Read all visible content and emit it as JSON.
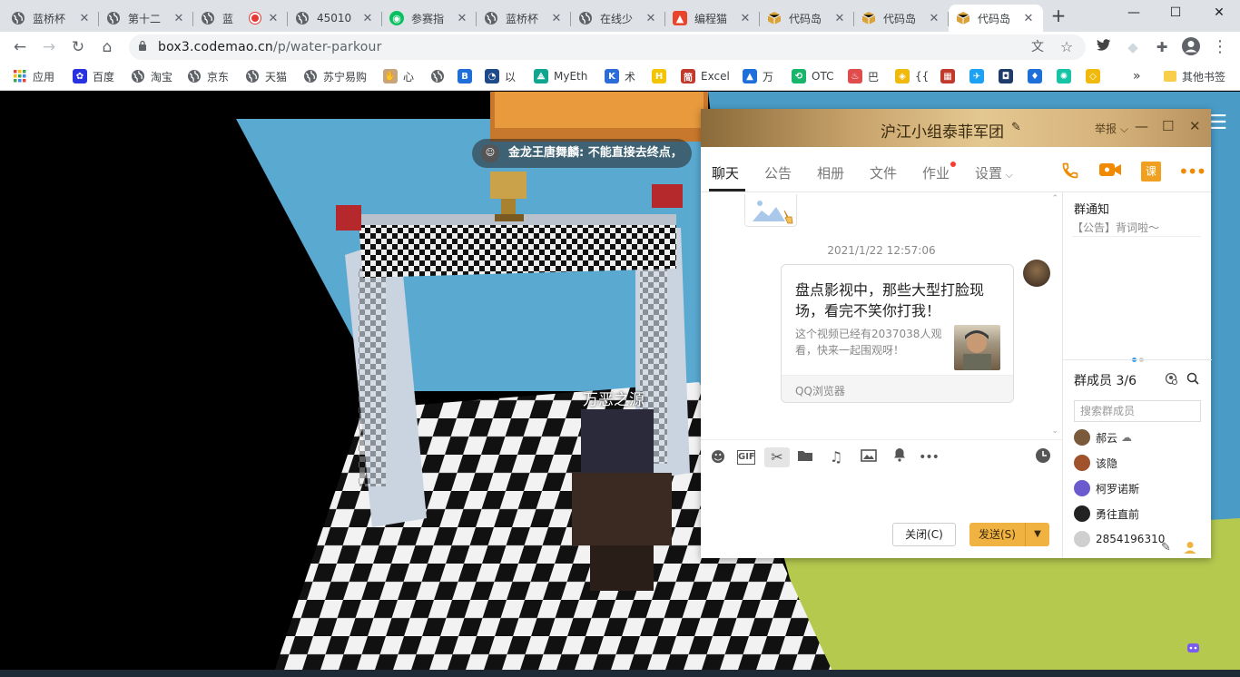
{
  "browser": {
    "tabs": [
      {
        "label": "蓝桥杯",
        "icon": "globe-icon",
        "icon_color": "#5f6368",
        "active": false
      },
      {
        "label": "第十二",
        "icon": "globe-icon",
        "icon_color": "#5f6368",
        "active": false
      },
      {
        "label": "蓝",
        "icon": "globe-icon",
        "icon_color": "#5f6368",
        "active": false,
        "recording": true
      },
      {
        "label": "45010",
        "icon": "globe-icon",
        "icon_color": "#5f6368",
        "active": false
      },
      {
        "label": "参赛指",
        "icon": "wechat-icon",
        "icon_color": "#07c160",
        "active": false
      },
      {
        "label": "蓝桥杯",
        "icon": "globe-icon",
        "icon_color": "#5f6368",
        "active": false
      },
      {
        "label": "在线少",
        "icon": "globe-icon",
        "icon_color": "#5f6368",
        "active": false
      },
      {
        "label": "编程猫",
        "icon": "codemao-icon",
        "icon_color": "#e8452c",
        "active": false
      },
      {
        "label": "代码岛",
        "icon": "box-icon",
        "icon_color": "#d9a33a",
        "active": false
      },
      {
        "label": "代码岛",
        "icon": "box-icon",
        "icon_color": "#d9a33a",
        "active": false
      },
      {
        "label": "代码岛",
        "icon": "box-icon",
        "icon_color": "#d9a33a",
        "active": true
      }
    ],
    "url": "box3.codemao.cn/p/water-parkour",
    "url_host": "box3.codemao.cn",
    "url_path": "/p/water-parkour",
    "bookmarks": [
      {
        "label": "应用",
        "icon": "apps-grid-icon",
        "color": "#4285f4"
      },
      {
        "label": "百度",
        "icon": "baidu-paw-icon",
        "color": "#2932e1"
      },
      {
        "label": "淘宝",
        "icon": "globe-icon",
        "color": "#5f6368"
      },
      {
        "label": "京东",
        "icon": "globe-icon",
        "color": "#5f6368"
      },
      {
        "label": "天猫",
        "icon": "globe-icon",
        "color": "#5f6368"
      },
      {
        "label": "苏宁易购",
        "icon": "globe-icon",
        "color": "#5f6368"
      },
      {
        "label": "心",
        "icon": "hand-icon",
        "color": "#c9a37a"
      },
      {
        "label": "",
        "icon": "globe-icon",
        "color": "#5f6368"
      },
      {
        "label": "",
        "icon": "b-square-icon",
        "color": "#1e6fd9"
      },
      {
        "label": "以",
        "icon": "chart-circle-icon",
        "color": "#1e4a8a"
      },
      {
        "label": "MyEth",
        "icon": "myeth-icon",
        "color": "#10a58f"
      },
      {
        "label": "术",
        "icon": "k-icon",
        "color": "#2b6cd9"
      },
      {
        "label": "",
        "icon": "h-square-icon",
        "color": "#f5c400"
      },
      {
        "label": "Excel",
        "icon": "jian-icon",
        "color": "#c0392b"
      },
      {
        "label": "万",
        "icon": "mountain-icon",
        "color": "#1e6fd9"
      },
      {
        "label": "OTC",
        "icon": "otc-icon",
        "color": "#18b56c"
      },
      {
        "label": "巴",
        "icon": "flame-icon",
        "color": "#e04b4b"
      },
      {
        "label": "{{",
        "icon": "binance-icon",
        "color": "#f0b90b"
      },
      {
        "label": "",
        "icon": "red-square-icon",
        "color": "#c0392b"
      },
      {
        "label": "",
        "icon": "twitter-icon",
        "color": "#1da1f2"
      },
      {
        "label": "",
        "icon": "dark-square-icon",
        "color": "#1f3b6a"
      },
      {
        "label": "",
        "icon": "drop-icon",
        "color": "#1e6fd9"
      },
      {
        "label": "",
        "icon": "ring-icon",
        "color": "#17c3a5"
      },
      {
        "label": "",
        "icon": "diamond-icon",
        "color": "#f0b90b"
      }
    ],
    "more_bookmarks": "»",
    "other_bookmarks": "其他书签"
  },
  "game": {
    "chat_line": "金龙王唐舞麟: 不能直接去终点，",
    "player_name": "万恶之源"
  },
  "qq": {
    "title": "沪江小组泰菲军团",
    "report": "举报",
    "tabs": [
      {
        "label": "聊天",
        "active": true
      },
      {
        "label": "公告",
        "active": false
      },
      {
        "label": "相册",
        "active": false
      },
      {
        "label": "文件",
        "active": false
      },
      {
        "label": "作业",
        "active": false,
        "badge": true
      },
      {
        "label": "设置",
        "active": false,
        "dropdown": true
      }
    ],
    "actions": [
      "phone-icon",
      "video-icon",
      "course-icon",
      "more-icon"
    ],
    "course_label": "课",
    "timestamp": "2021/1/22 12:57:06",
    "card": {
      "title": "盘点影视中，那些大型打脸现场，看完不笑你打我！",
      "desc": "这个视频已经有2037038人观看，快来一起围观呀！",
      "source": "QQ浏览器"
    },
    "input_toolbar": [
      "smiley-icon",
      "gif-icon",
      "scissors-icon",
      "folder-icon",
      "music-icon",
      "image-icon",
      "bell-icon",
      "more-dots-icon",
      "clock-icon"
    ],
    "gif_label": "GIF",
    "close_button": "关闭(C)",
    "send_button": "发送(S)",
    "sidebar": {
      "notice_title": "群通知",
      "notice_text": "【公告】背词啦～",
      "members_title": "群成员 3/6",
      "search_placeholder": "搜索群成员",
      "members": [
        {
          "name": "郝云",
          "suffix": "☁",
          "color": "#7a5a3a"
        },
        {
          "name": "该隐",
          "suffix": "",
          "color": "#a0522d"
        },
        {
          "name": "柯罗诺斯",
          "suffix": "",
          "color": "#6a5acd"
        },
        {
          "name": "勇往直前",
          "suffix": "",
          "color": "#222222"
        },
        {
          "name": "2854196310",
          "suffix": "",
          "color": "#cfcfcf"
        }
      ]
    }
  }
}
